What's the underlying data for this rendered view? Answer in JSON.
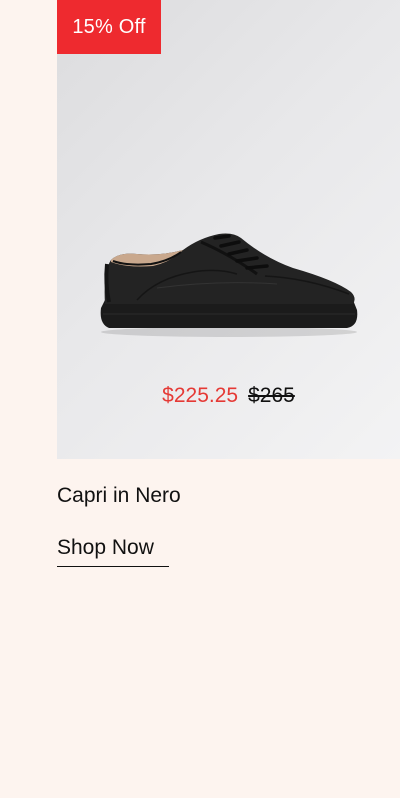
{
  "product": {
    "badge": "15% Off",
    "image_alt": "Black leather low-top sneaker",
    "sale_price": "$225.25",
    "original_price": "$265",
    "name": "Capri in Nero",
    "cta_label": "Shop Now"
  },
  "colors": {
    "page_background": "#fdf4ef",
    "badge_background": "#ee2a2f",
    "sale_price": "#e53935",
    "text": "#111111"
  }
}
